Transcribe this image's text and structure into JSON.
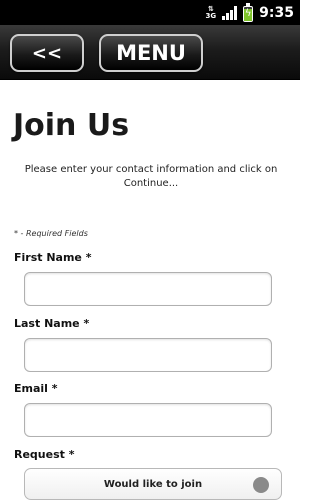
{
  "status_bar": {
    "network": "3G",
    "time": "9:35",
    "battery_level": 0.8
  },
  "header": {
    "back_label": "<<",
    "menu_label": "MENU"
  },
  "page": {
    "title": "Join Us",
    "intro": "Please enter your contact information and click on Continue...",
    "required_note": "* - Required Fields"
  },
  "form": {
    "first_name": {
      "label": "First Name *",
      "value": "",
      "placeholder": ""
    },
    "last_name": {
      "label": "Last Name *",
      "value": "",
      "placeholder": ""
    },
    "email": {
      "label": "Email *",
      "value": "",
      "placeholder": ""
    },
    "request": {
      "label": "Request *",
      "selected": "Would like to join"
    }
  }
}
